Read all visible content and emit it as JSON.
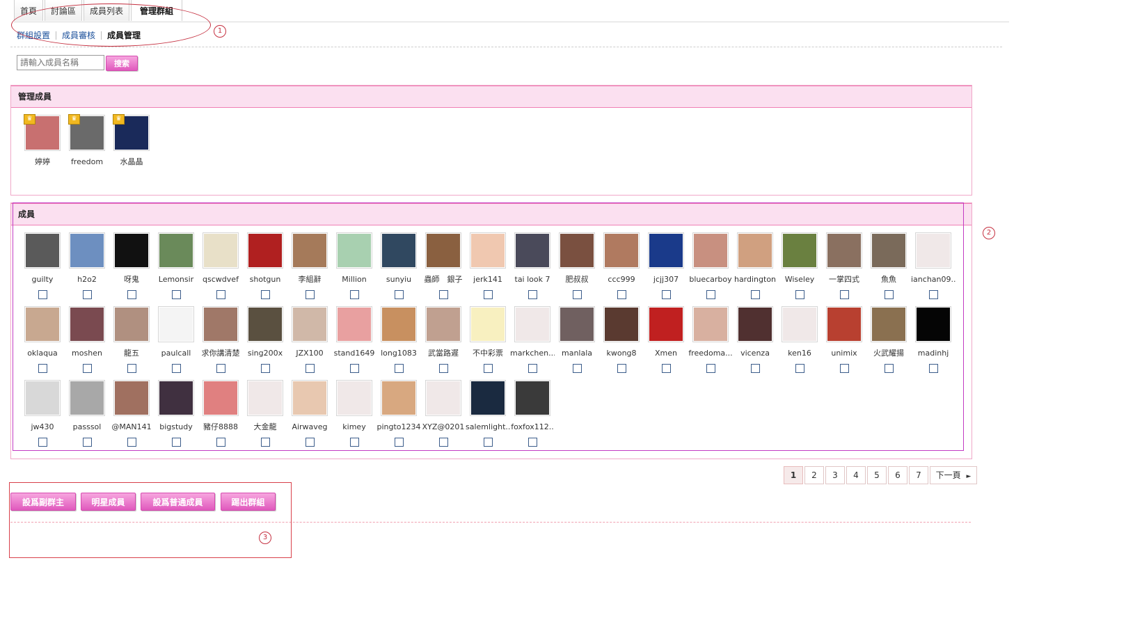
{
  "tabs": [
    "首頁",
    "討論區",
    "成員列表",
    "管理群組"
  ],
  "subnav": [
    "群組設置",
    "成員審核",
    "成員管理"
  ],
  "search": {
    "placeholder": "請輸入成員名稱",
    "button": "搜索"
  },
  "admin_panel": {
    "title": "管理成員",
    "members": [
      "婷婷",
      "freedom",
      "水晶晶"
    ]
  },
  "member_panel": {
    "title": "成員",
    "members": [
      "guilty",
      "h2o2",
      "呀鬼",
      "Lemonsir",
      "qscwdvef",
      "shotgun",
      "李組辭",
      "Million",
      "sunyiu",
      "蟲師　銀子",
      "jerk141",
      "tai look 7",
      "肥叔叔",
      "ccc999",
      "jcjj307",
      "bluecarboy",
      "hardington",
      "Wiseley",
      "一掌四式",
      "魚魚",
      "ianchan09..",
      "oklaqua",
      "moshen",
      "龍五",
      "paulcall",
      "求你講清楚",
      "sing200x",
      "JZX100",
      "stand1649",
      "long1083",
      "武當路遲",
      "不中彩票",
      "markchen...",
      "manlala",
      "kwong8",
      "Xmen",
      "freedoma...",
      "vicenza",
      "ken16",
      "unimix",
      "火武耀揚",
      "madinhj",
      "jw430",
      "passsol",
      "@MAN141",
      "bigstudy",
      "豬仔8888",
      "大金龍",
      "Airwaveg",
      "kimey",
      "pingto1234",
      "XYZ@0201",
      "salemlight...",
      "foxfox112.."
    ],
    "avatar_colors": [
      "#5a5a5a",
      "#6d8fc0",
      "#111111",
      "#6a8a5a",
      "#e8e0c8",
      "#b02020",
      "#a57a5a",
      "#a8d0b0",
      "#304860",
      "#8a6040",
      "#f0c8b0",
      "#4a4a5a",
      "#7a5040",
      "#b07a60",
      "#1a3a8a",
      "#c89080",
      "#d0a080",
      "#6a8040",
      "#8a7060",
      "#7a6a5a",
      "#f0e8e8",
      "#c8a890",
      "#7a4a50",
      "#b09080",
      "#f4f4f4",
      "#a07868",
      "#5a5040",
      "#d0b8a8",
      "#e8a0a0",
      "#c89060",
      "#c0a090",
      "#f8f0c0",
      "#f0e8e8",
      "#706060",
      "#5a3a30",
      "#c02020",
      "#d8b0a0",
      "#503030",
      "#f0e8e8",
      "#b84030",
      "#8a7050",
      "#050505",
      "#d8d8d8",
      "#a8a8a8",
      "#a07060",
      "#403040",
      "#e08080",
      "#f0e8e8",
      "#e8c8b0",
      "#f0e8e8",
      "#d8a880",
      "#f0e8e8",
      "#1a2a40",
      "#3a3a3a"
    ]
  },
  "admin_avatar_colors": [
    "#c87070",
    "#6a6a6a",
    "#1a2a5a"
  ],
  "pagination": {
    "pages": [
      "1",
      "2",
      "3",
      "4",
      "5",
      "6",
      "7"
    ],
    "next": "下一頁"
  },
  "actions": [
    "設爲副群主",
    "明星成員",
    "設爲普通成員",
    "踢出群組"
  ],
  "annotations": [
    "1",
    "2",
    "3"
  ],
  "colors": {
    "accent": "#e059bd",
    "panel_header": "#fbe0f0",
    "annotation": "#c53040"
  }
}
